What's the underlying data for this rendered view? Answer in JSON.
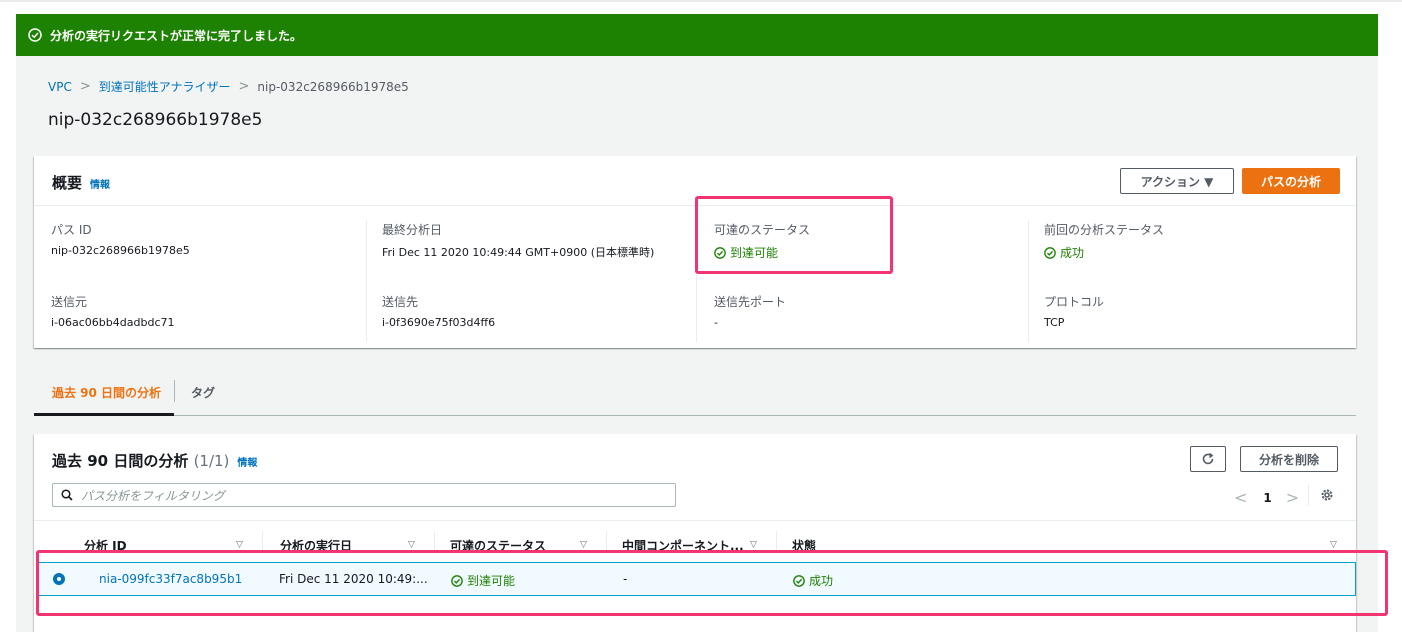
{
  "flash": {
    "message": "分析の実行リクエストが正常に完了しました。"
  },
  "breadcrumb": {
    "items": [
      "VPC",
      "到達可能性アナライザー",
      "nip-032c268966b1978e5"
    ]
  },
  "page_title": "nip-032c268966b1978e5",
  "overview": {
    "title": "概要",
    "info": "情報",
    "actions_label": "アクション ▼",
    "analyze_label": "パスの分析",
    "fields": {
      "path_id": {
        "label": "パス ID",
        "value": "nip-032c268966b1978e5"
      },
      "last_analyzed": {
        "label": "最終分析日",
        "value": "Fri Dec 11 2020 10:49:44 GMT+0900 (日本標準時)"
      },
      "reachability": {
        "label": "可達のステータス",
        "value": "到達可能"
      },
      "prev_status": {
        "label": "前回の分析ステータス",
        "value": "成功"
      },
      "source": {
        "label": "送信元",
        "value": "i-06ac06bb4dadbdc71"
      },
      "destination": {
        "label": "送信先",
        "value": "i-0f3690e75f03d4ff6"
      },
      "dest_port": {
        "label": "送信先ポート",
        "value": "-"
      },
      "protocol": {
        "label": "プロトコル",
        "value": "TCP"
      }
    }
  },
  "tabs": [
    "過去 90 日間の分析",
    "タグ"
  ],
  "analyses": {
    "title": "過去 90 日間の分析",
    "count": "(1/1)",
    "info": "情報",
    "delete_label": "分析を削除",
    "search_placeholder": "パス分析をフィルタリング",
    "page": "1",
    "columns": [
      "分析 ID",
      "分析の実行日",
      "可達のステータス",
      "中間コンポーネント...",
      "状態"
    ],
    "rows": [
      {
        "id": "nia-099fc33f7ac8b95b1",
        "date": "Fri Dec 11 2020 10:49:...",
        "reachability": "到達可能",
        "intermediate": "-",
        "state": "成功"
      }
    ]
  },
  "colors": {
    "success": "#1d8102",
    "accent": "#ec7211",
    "link": "#0073bb",
    "highlight": "#f23570"
  }
}
